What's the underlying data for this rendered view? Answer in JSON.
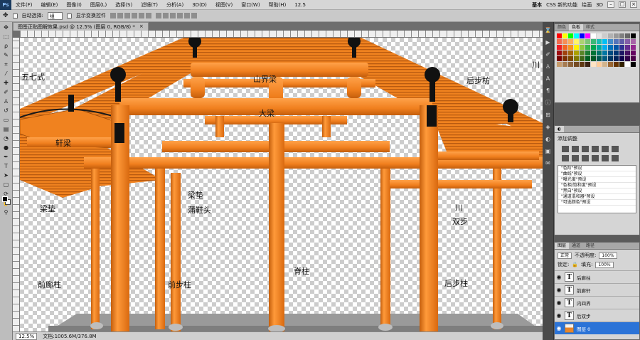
{
  "menubar": {
    "app_logo": "Ps",
    "items": [
      "文件(F)",
      "编辑(E)",
      "图像(I)",
      "图层(L)",
      "选择(S)",
      "滤镜(T)",
      "分析(A)",
      "3D(D)",
      "视图(V)",
      "窗口(W)",
      "帮助(H)"
    ],
    "zoom": "12.5",
    "workspaces": [
      "基本",
      "CSS 新的功能",
      "绘画",
      "3D"
    ],
    "active_workspace": "基本"
  },
  "options": {
    "auto_select_label": "自动选择:",
    "auto_select_value": "组",
    "show_transform_label": "显示变换控件"
  },
  "document": {
    "tab_title": "图签正贴图解效果.psd @ 12.5% (图层 0, RGB/8) *",
    "close": "×",
    "zoom": "12.5%",
    "doc_size": "文档:1005.6M/376.8M",
    "labels": {
      "wuqi": "五七式",
      "shanjieliang": "山界梁",
      "houbufang": "后步枋",
      "chuan_top": "川",
      "daliang": "大梁",
      "xuanliang": "轩梁",
      "liangdian_left": "梁垫",
      "liangdian_mid": "梁垫",
      "puxietou": "蒲鞋头",
      "chuan": "川",
      "shuangbu": "双步",
      "qianlangzhu": "前廊柱",
      "qianbuzhu": "前步柱",
      "jizhu": "脊柱",
      "houbuzhu": "后步柱"
    }
  },
  "panels": {
    "color_tabs": [
      "颜色",
      "色板",
      "样式"
    ],
    "swatches": [
      "#ff0000",
      "#ffff00",
      "#00ff00",
      "#00ffff",
      "#0000ff",
      "#ff00ff",
      "#ffffff",
      "#e5e5e5",
      "#cccccc",
      "#b2b2b2",
      "#999999",
      "#7f7f7f",
      "#666666",
      "#000000",
      "#f26c4f",
      "#f68e56",
      "#fbaf5d",
      "#fff568",
      "#acd372",
      "#7cc576",
      "#3bb878",
      "#1abbb4",
      "#00bff3",
      "#438ccb",
      "#5574b9",
      "#605ca8",
      "#855fa8",
      "#a763a8",
      "#ed1c24",
      "#f26522",
      "#f7941d",
      "#fff200",
      "#8dc73f",
      "#39b54a",
      "#00a651",
      "#00a99d",
      "#00aeef",
      "#0072bc",
      "#0054a6",
      "#2e3192",
      "#662d91",
      "#92278f",
      "#9e0b0f",
      "#a0410d",
      "#a36209",
      "#aba000",
      "#598527",
      "#1a7b30",
      "#007236",
      "#00746b",
      "#0076a3",
      "#004b80",
      "#003471",
      "#1b1464",
      "#440e62",
      "#630460",
      "#790000",
      "#7b2e00",
      "#7d4900",
      "#827b00",
      "#406618",
      "#005e20",
      "#005826",
      "#005952",
      "#005b7f",
      "#003663",
      "#002157",
      "#0d004c",
      "#32004b",
      "#4b0049",
      "#c69c6d",
      "#a67c52",
      "#8c6239",
      "#754c24",
      "#603913",
      "#3c2415",
      "#ffe4c4",
      "#ffcc99",
      "#d2b48c",
      "#996633",
      "#663300",
      "#332200",
      "#ffffff",
      "#000000"
    ],
    "adjustments_title": "添加调整",
    "presets": [
      "\"色阶\"预设",
      "\"曲线\"预设",
      "\"曝光度\"预设",
      "\"色相/饱和度\"预设",
      "\"黑白\"预设",
      "\"通道混和器\"预设",
      "\"可选颜色\"预设"
    ],
    "layers_tabs": [
      "图层",
      "通道",
      "路径"
    ],
    "blend_mode": "正常",
    "opacity_label": "不透明度:",
    "opacity": "100%",
    "fill_label": "填充:",
    "fill": "100%",
    "lock_label": "锁定:",
    "layers": [
      {
        "name": "后廊柱",
        "type": "text"
      },
      {
        "name": "前廊轩",
        "type": "text"
      },
      {
        "name": "内四界",
        "type": "text"
      },
      {
        "name": "后双步",
        "type": "text"
      },
      {
        "name": "图层 0",
        "type": "image",
        "selected": true
      }
    ]
  },
  "colors": {
    "beam_orange": "#f07f1e",
    "beam_shadow": "#c45e0c",
    "selection_blue": "#2b73d7"
  }
}
